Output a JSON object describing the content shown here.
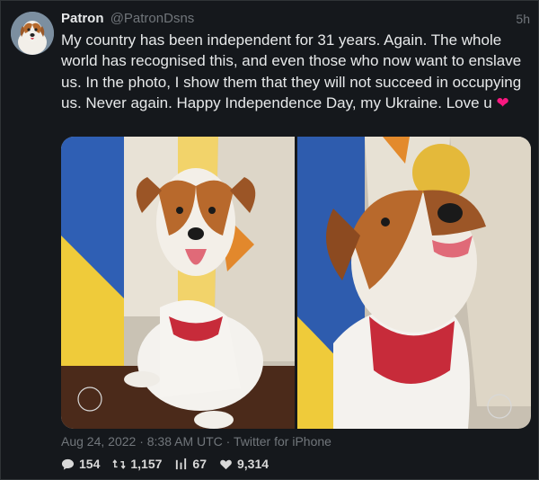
{
  "author": {
    "name": "Patron",
    "handle": "@PatronDsns",
    "avatar_icon": "dog-avatar-icon"
  },
  "tweet": {
    "time_ago": "5h",
    "text": "My country has been independent for 31 years. Again. The whole world has recognised this, and even those who now want to enslave us. In the photo, I show them that they will not succeed in occupying us. Never again. Happy Independence Day, my Ukraine. Love u",
    "emoji": "❤"
  },
  "media": [
    {
      "description_icon": "dog-photo-sitting"
    },
    {
      "description_icon": "dog-photo-closeup"
    }
  ],
  "meta": {
    "date": "Aug 24, 2022",
    "separator": "·",
    "time": "8:38 AM UTC",
    "source": "Twitter for iPhone"
  },
  "stats": {
    "replies": "154",
    "retweets": "1,157",
    "quotes": "67",
    "likes": "9,314"
  },
  "colors": {
    "background": "#15181c",
    "text": "#e7e9ea",
    "muted": "#71767b",
    "heart": "#f91880"
  }
}
